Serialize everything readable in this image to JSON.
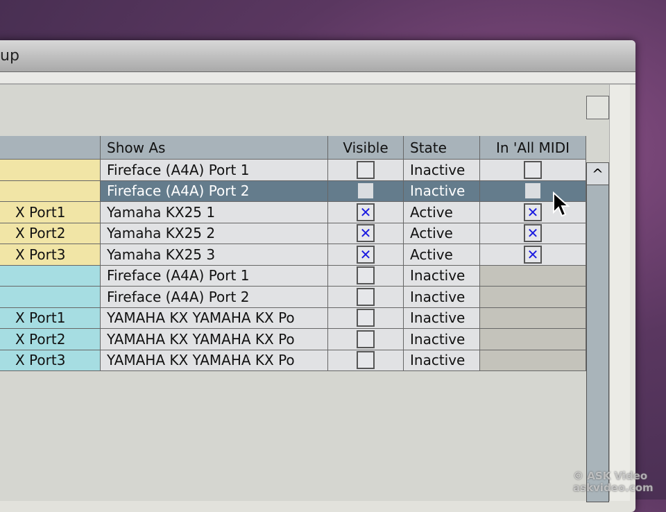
{
  "window": {
    "title": "up"
  },
  "table": {
    "headers": [
      "",
      "Show As",
      "Visible",
      "State",
      "In 'All MIDI"
    ],
    "rows": [
      {
        "port": "",
        "show_as": "Fireface (A4A) Port 1",
        "visible": false,
        "state": "Inactive",
        "in_all_midi": false,
        "color": "#f1e5a6",
        "selected": false
      },
      {
        "port": "",
        "show_as": "Fireface (A4A) Port 2",
        "visible": false,
        "state": "Inactive",
        "in_all_midi": false,
        "color": "#f1e5a6",
        "selected": true
      },
      {
        "port": "X Port1",
        "show_as": "Yamaha KX25 1",
        "visible": true,
        "state": "Active",
        "in_all_midi": true,
        "color": "#f1e5a6",
        "selected": false
      },
      {
        "port": "X Port2",
        "show_as": "Yamaha KX25 2",
        "visible": true,
        "state": "Active",
        "in_all_midi": true,
        "color": "#f1e5a6",
        "selected": false
      },
      {
        "port": "X Port3",
        "show_as": "Yamaha KX25 3",
        "visible": true,
        "state": "Active",
        "in_all_midi": true,
        "color": "#f1e5a6",
        "selected": false
      },
      {
        "port": "",
        "show_as": "Fireface (A4A) Port 1",
        "visible": false,
        "state": "Inactive",
        "in_all_midi": null,
        "color": "#a6dde2",
        "selected": false
      },
      {
        "port": "",
        "show_as": "Fireface (A4A) Port 2",
        "visible": false,
        "state": "Inactive",
        "in_all_midi": null,
        "color": "#a6dde2",
        "selected": false
      },
      {
        "port": "X Port1",
        "show_as": "YAMAHA KX YAMAHA KX Po",
        "visible": false,
        "state": "Inactive",
        "in_all_midi": null,
        "color": "#a6dde2",
        "selected": false
      },
      {
        "port": "X Port2",
        "show_as": "YAMAHA KX YAMAHA KX Po",
        "visible": false,
        "state": "Inactive",
        "in_all_midi": null,
        "color": "#a6dde2",
        "selected": false
      },
      {
        "port": "X Port3",
        "show_as": "YAMAHA KX YAMAHA KX Po",
        "visible": false,
        "state": "Inactive",
        "in_all_midi": null,
        "color": "#a6dde2",
        "selected": false
      }
    ]
  },
  "scrollbar": {
    "up_icon": "^"
  },
  "watermark": {
    "line1": "© ASK Video",
    "line2": "askvideo.com"
  }
}
